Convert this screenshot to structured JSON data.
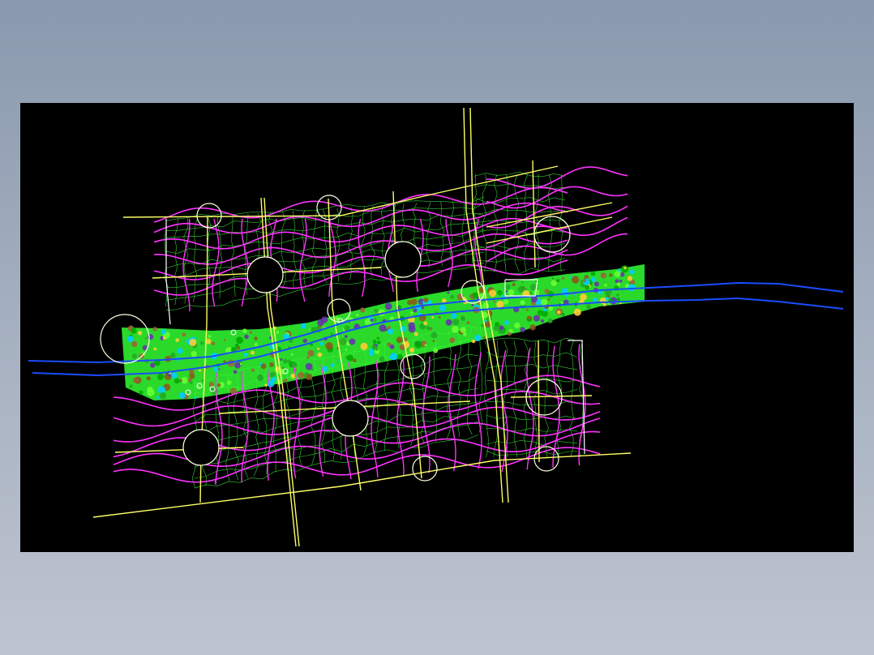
{
  "drawing": {
    "background_outer": "#8a99ae",
    "background_canvas": "#000000",
    "colors": {
      "road": "#ffff66",
      "circle": "#ffffe0",
      "contour": "#ff33ff",
      "grid": "#33cc33",
      "river": "#1a4dff",
      "park": "#33ff33",
      "building": "#ffffff"
    },
    "layers": [
      "roads",
      "nodes",
      "contours",
      "parcel-grid",
      "riverside-park",
      "river",
      "buildings"
    ]
  }
}
